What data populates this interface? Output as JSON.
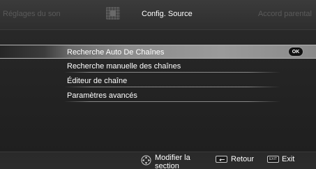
{
  "header": {
    "tabs": [
      {
        "label": "Réglages du son",
        "active": false
      },
      {
        "label": "Config. Source",
        "active": true
      },
      {
        "label": "Accord parental",
        "active": false
      }
    ],
    "source_icon": "source-input-icon"
  },
  "menu": {
    "items": [
      {
        "label": "Recherche Auto De Chaînes",
        "selected": true
      },
      {
        "label": "Recherche manuelle des chaînes",
        "selected": false
      },
      {
        "label": "Éditeur de chaîne",
        "selected": false
      },
      {
        "label": "Paramètres avancés",
        "selected": false
      }
    ],
    "ok_badge": "OK"
  },
  "footer": {
    "modify_label": "Modifier la section",
    "back_key_icon": "back-arrow-icon",
    "back_label": "Retour",
    "exit_key": "EXIT",
    "exit_label": "Exit",
    "nav_icon": "navigation-dpad-icon"
  },
  "colors": {
    "background": "#242424",
    "header": "#333333",
    "selected_highlight": "#8c8c8c",
    "inactive_tab": "#5a5a5a",
    "text": "#ffffff"
  }
}
